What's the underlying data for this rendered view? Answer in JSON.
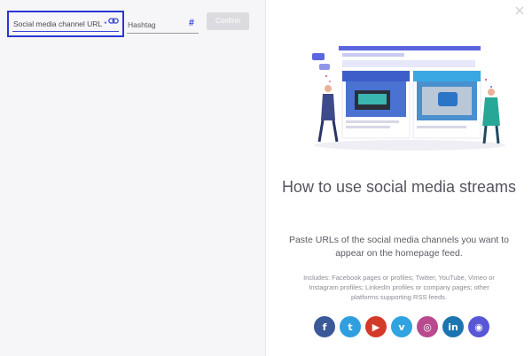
{
  "left_panel": {
    "url_field": {
      "label": "Social media channel URL",
      "required_mark": "*",
      "icon": "link-icon"
    },
    "hashtag_field": {
      "label": "Hashtag",
      "icon": "#"
    },
    "confirm_label": "Confirm"
  },
  "right_panel": {
    "close_icon": "close-icon",
    "title": "How to use social media streams",
    "subtitle": "Paste URLs of the social media channels you want to appear on the homepage feed.",
    "note": "Includes: Facebook pages or profiles; Twitter, YouTube, Vimeo or Instagram profiles; LinkedIn profiles or company pages; other platforms supporting RSS feeds.",
    "socials": [
      {
        "name": "facebook",
        "glyph": "f",
        "color": "#3b5998"
      },
      {
        "name": "twitter",
        "glyph": "t",
        "color": "#2f9fe0"
      },
      {
        "name": "youtube",
        "glyph": "▶",
        "color": "#d43a2a"
      },
      {
        "name": "vimeo",
        "glyph": "v",
        "color": "#2fa4e0"
      },
      {
        "name": "instagram",
        "glyph": "◎",
        "color": "#b84a8e"
      },
      {
        "name": "linkedin",
        "glyph": "in",
        "color": "#1c75b0"
      },
      {
        "name": "rss",
        "glyph": "◉",
        "color": "#5757d8"
      }
    ]
  },
  "colors": {
    "accent": "#2a37d6",
    "panel_bg": "#f6f6f8",
    "button_disabled": "#dcdce0"
  }
}
